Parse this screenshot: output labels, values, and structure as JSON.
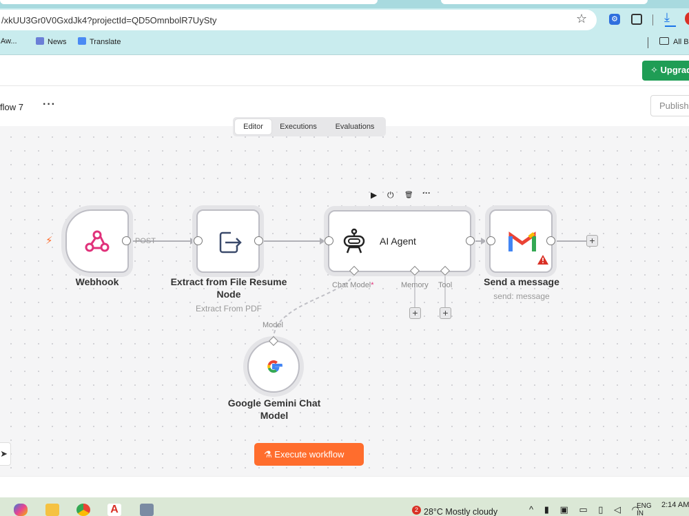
{
  "browser": {
    "url": "/xkUU3Gr0V0GxdJk4?projectId=QD5OmnbolR7UySty",
    "bookmarks": [
      {
        "label": "i Aw...",
        "icon": "app-icon"
      },
      {
        "label": "News",
        "icon": "news-icon"
      },
      {
        "label": "Translate",
        "icon": "translate-icon"
      }
    ],
    "all_bookmarks_label": "All B"
  },
  "header": {
    "upgrade_label": "Upgrad"
  },
  "workflow": {
    "title": "flow 7",
    "more": "···",
    "publish_label": "Publish"
  },
  "tabs": [
    {
      "label": "Editor",
      "active": true
    },
    {
      "label": "Executions",
      "active": false
    },
    {
      "label": "Evaluations",
      "active": false
    }
  ],
  "nodes": {
    "webhook": {
      "label": "Webhook",
      "connection_label": "POST",
      "icon": "webhook-icon"
    },
    "extract": {
      "label": "Extract from File Resume Node",
      "subtitle": "Extract From PDF",
      "icon": "extract-file-icon"
    },
    "agent": {
      "label": "AI Agent",
      "icon": "robot-icon",
      "chat_model_label": "Chat Model",
      "required_mark": "*",
      "memory_label": "Memory",
      "tool_label": "Tool"
    },
    "gmail": {
      "label": "Send a message",
      "subtitle": "send: message",
      "icon": "gmail-icon"
    },
    "gemini": {
      "label": "Google Gemini Chat Model",
      "model_label": "Model",
      "icon": "google-icon"
    }
  },
  "node_toolbar": [
    "▶",
    "⏻",
    "🗑",
    "···"
  ],
  "execute_label": "Execute workflow",
  "colors": {
    "accent": "#ff6d2d",
    "upgrade": "#1f9d55",
    "warning": "#d93025"
  },
  "taskbar": {
    "weather_badge": "2",
    "weather": "28°C  Mostly cloudy",
    "lang": "ENG",
    "lang2": "IN",
    "time": "2:14 AM"
  }
}
